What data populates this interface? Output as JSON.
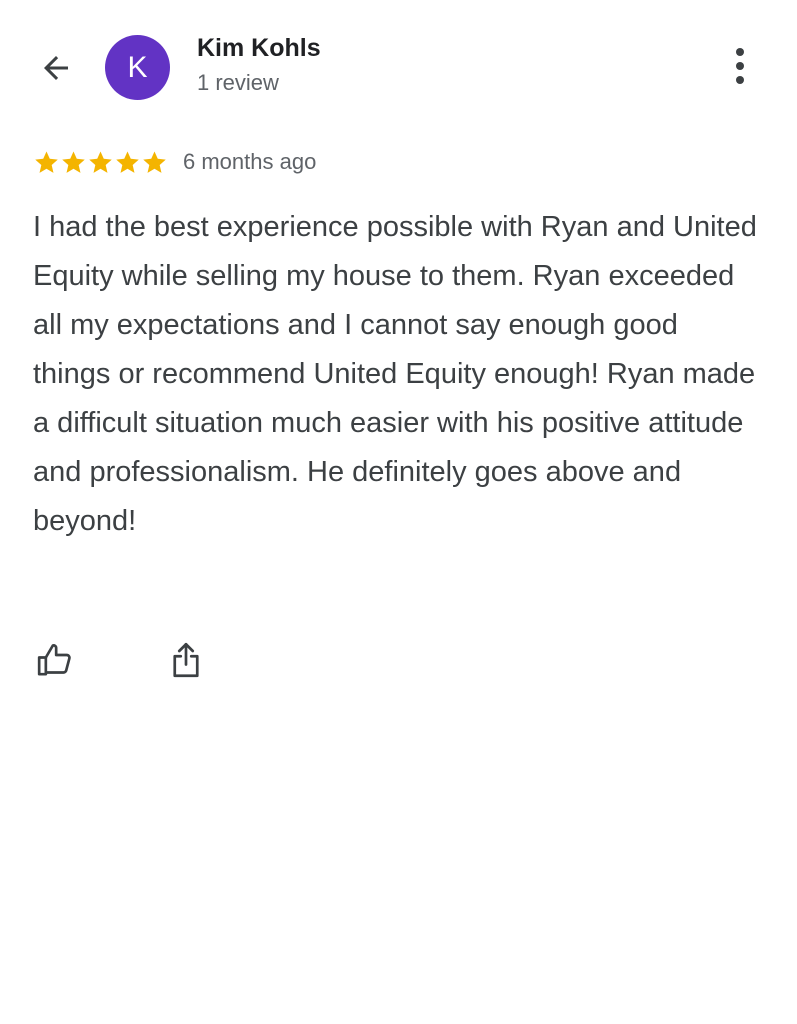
{
  "header": {
    "back_icon": "arrow-left-icon",
    "avatar_letter": "K",
    "avatar_color": "#6233c4",
    "reviewer_name": "Kim Kohls",
    "review_count": "1 review",
    "more_icon": "more-vertical-icon"
  },
  "review": {
    "rating": 5,
    "rating_max": 5,
    "star_color": "#f4b400",
    "date": "6 months ago",
    "text": "I had the best experience possible with Ryan and United Equity while selling my house to them. Ryan exceeded all my expectations and I cannot say enough good things or recommend United Equity enough! Ryan made a difficult situation much easier with his positive attitude and professionalism. He definitely goes above and beyond!"
  },
  "actions": {
    "like_icon": "thumbs-up-icon",
    "share_icon": "share-icon"
  }
}
